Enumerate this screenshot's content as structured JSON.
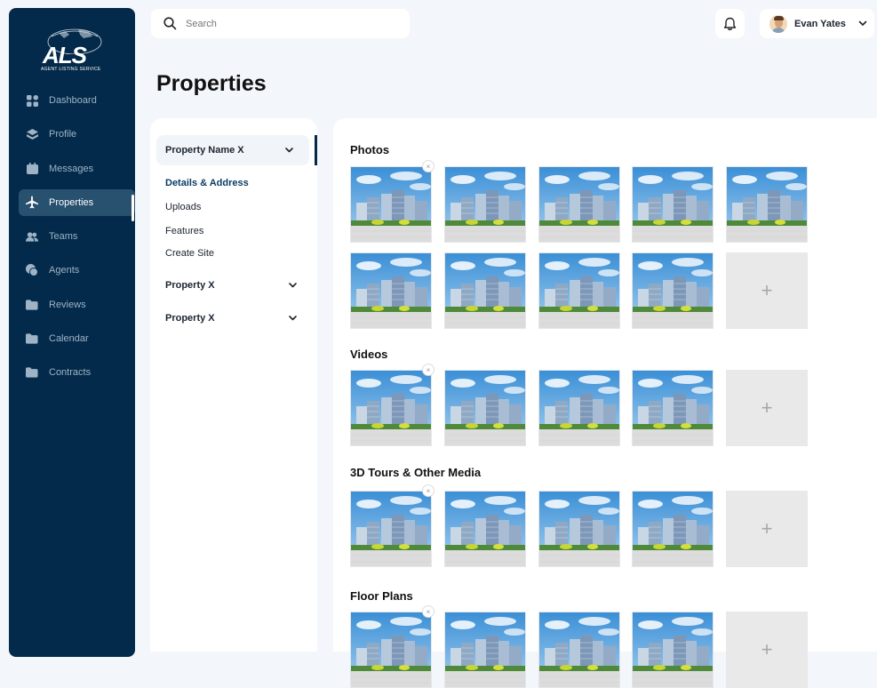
{
  "brand": {
    "logo_text": "ALS",
    "logo_sub": "AGENT LISTING SERVICE"
  },
  "sidebar": {
    "items": [
      {
        "label": "Dashboard",
        "icon": "grid-icon"
      },
      {
        "label": "Profile",
        "icon": "layers-icon"
      },
      {
        "label": "Messages",
        "icon": "calendar-icon"
      },
      {
        "label": "Properties",
        "icon": "plane-icon",
        "active": true
      },
      {
        "label": "Teams",
        "icon": "people-icon"
      },
      {
        "label": "Agents",
        "icon": "chat-icon"
      },
      {
        "label": "Reviews",
        "icon": "folder-icon"
      },
      {
        "label": "Calendar",
        "icon": "folder-icon"
      },
      {
        "label": "Contracts",
        "icon": "folder-icon"
      }
    ]
  },
  "topbar": {
    "search_placeholder": "Search",
    "user_name": "Evan Yates"
  },
  "page": {
    "title": "Properties"
  },
  "subpanel": {
    "property_header": "Property Name X",
    "sub_items": [
      "Details & Address",
      "Uploads",
      "Features",
      "Create Site"
    ],
    "properties": [
      "Property X",
      "Property X"
    ]
  },
  "media": {
    "sections": [
      {
        "title": "Photos",
        "image_count": 9,
        "has_add": true
      },
      {
        "title": "Videos",
        "image_count": 4,
        "has_add": true
      },
      {
        "title": "3D Tours & Other Media",
        "image_count": 4,
        "has_add": true
      },
      {
        "title": "Floor Plans",
        "image_count": 4,
        "has_add": true
      }
    ],
    "add_symbol": "+",
    "close_symbol": "×"
  },
  "colors": {
    "sidebar_bg": "#032a4a",
    "active_nav": "#28506f",
    "page_bg": "#f3f6fa"
  }
}
